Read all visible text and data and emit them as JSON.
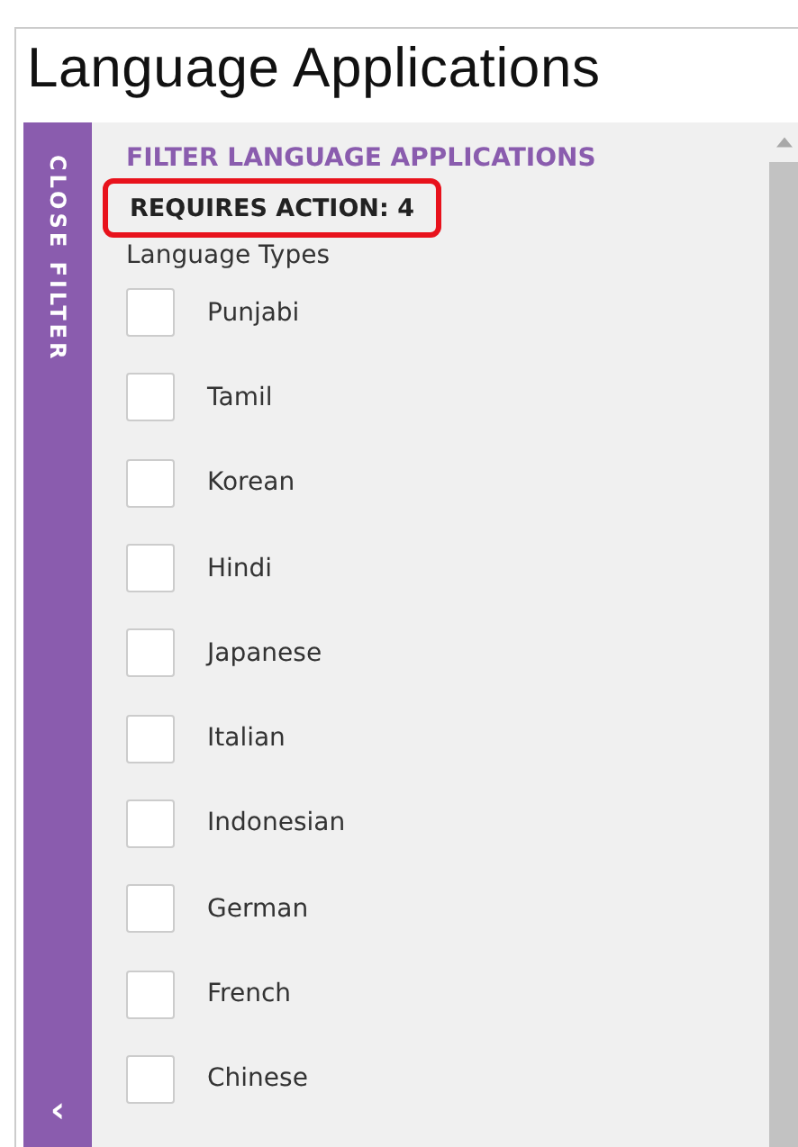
{
  "page": {
    "title": "Language Applications"
  },
  "sidebar": {
    "toggle_label": "CLOSE FILTER",
    "collapse_glyph": "‹"
  },
  "filter": {
    "heading": "FILTER LANGUAGE APPLICATIONS",
    "requires_action": "REQUIRES ACTION: 4",
    "highlighted": true,
    "group_label": "Language Types",
    "options": [
      {
        "label": "Punjabi",
        "checked": false
      },
      {
        "label": "Tamil",
        "checked": false
      },
      {
        "label": "Korean",
        "checked": false
      },
      {
        "label": "Hindi",
        "checked": false
      },
      {
        "label": "Japanese",
        "checked": false
      },
      {
        "label": "Italian",
        "checked": false
      },
      {
        "label": "Indonesian",
        "checked": false
      },
      {
        "label": "German",
        "checked": false
      },
      {
        "label": "French",
        "checked": false
      },
      {
        "label": "Chinese",
        "checked": false
      }
    ]
  }
}
